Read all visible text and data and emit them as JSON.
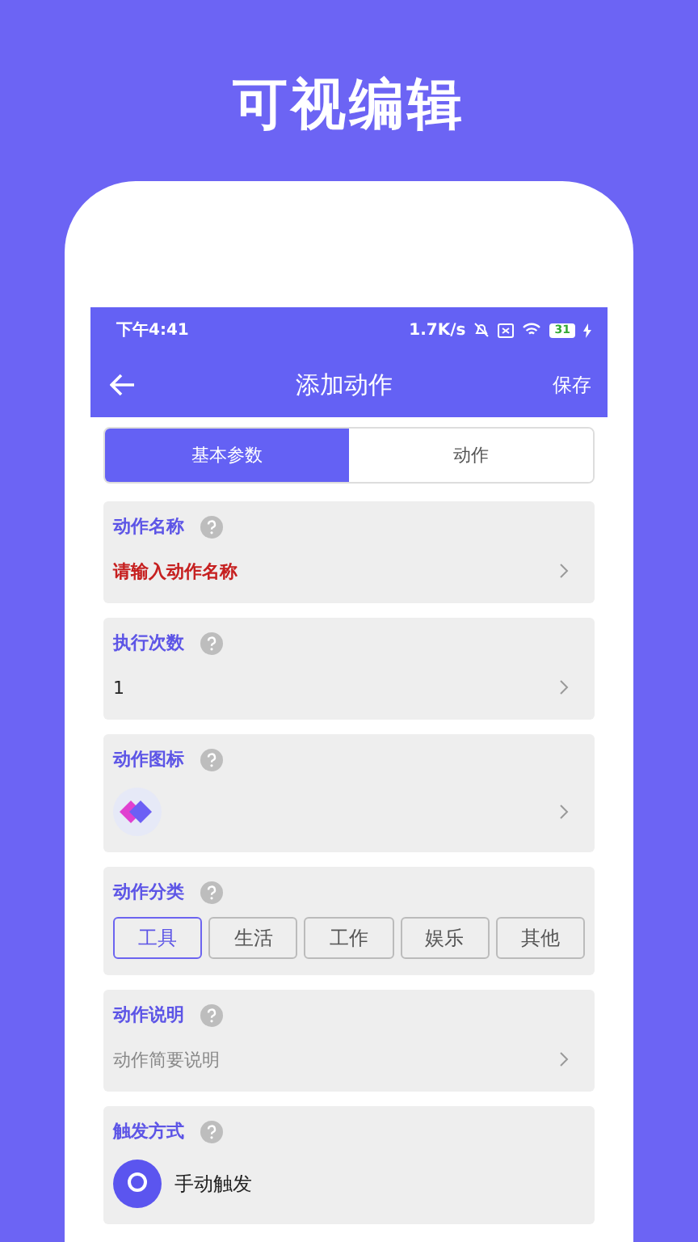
{
  "headline": "可视编辑",
  "status_bar": {
    "time": "下午4:41",
    "speed": "1.7K/s",
    "battery": "31"
  },
  "app_bar": {
    "title": "添加动作",
    "action": "保存"
  },
  "tabs": [
    {
      "label": "基本参数",
      "selected": true
    },
    {
      "label": "动作",
      "selected": false
    }
  ],
  "fields": [
    {
      "kind": "input",
      "label": "动作名称",
      "placeholder": "请输入动作名称",
      "required": true
    },
    {
      "kind": "input",
      "label": "执行次数",
      "value": "1"
    },
    {
      "kind": "icon",
      "label": "动作图标"
    },
    {
      "kind": "chips",
      "label": "动作分类",
      "options": [
        {
          "label": "工具",
          "selected": true
        },
        {
          "label": "生活",
          "selected": false
        },
        {
          "label": "工作",
          "selected": false
        },
        {
          "label": "娱乐",
          "selected": false
        },
        {
          "label": "其他",
          "selected": false
        }
      ]
    },
    {
      "kind": "input",
      "label": "动作说明",
      "placeholder": "动作简要说明",
      "required": false
    },
    {
      "kind": "trigger",
      "label": "触发方式",
      "value": "手动触发"
    }
  ]
}
